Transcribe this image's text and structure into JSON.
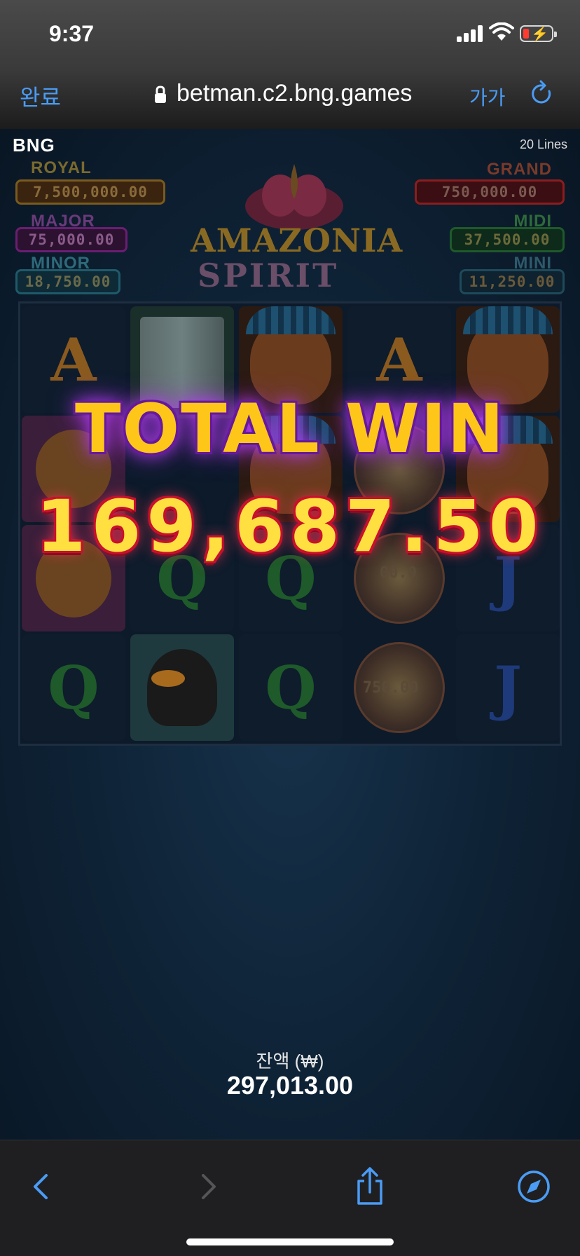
{
  "status_bar": {
    "time": "9:37"
  },
  "url_bar": {
    "done_label": "완료",
    "url": "betman.c2.bng.games",
    "text_size_label": "가가"
  },
  "game": {
    "provider_logo": "BNG",
    "lines_label": "20 Lines",
    "jackpots": {
      "royal": {
        "label": "ROYAL",
        "value": "7,500,000.00"
      },
      "major": {
        "label": "MAJOR",
        "value": "75,000.00"
      },
      "minor": {
        "label": "MINOR",
        "value": "18,750.00"
      },
      "grand": {
        "label": "GRAND",
        "value": "750,000.00"
      },
      "midi": {
        "label": "MIDI",
        "value": "37,500.00"
      },
      "mini": {
        "label": "MINI",
        "value": "11,250.00"
      }
    },
    "title_line1": "AMAZONIA",
    "title_line2": "SPIRIT",
    "reels": {
      "col1": [
        "A",
        "monkey",
        "monkey",
        "Q"
      ],
      "col2": [
        "waterfall",
        "Q",
        "toucan"
      ],
      "col3": [
        "chief",
        "chief",
        "Q",
        "Q"
      ],
      "col4": [
        "A",
        "butterfly",
        "butterfly",
        "butterfly"
      ],
      "col5": [
        "chief",
        "chief",
        "J",
        "J"
      ],
      "cell_values": {
        "c4r3": "00.0",
        "c4r4": "750.00"
      }
    },
    "total_win_label": "TOTAL WIN",
    "win_amount": "169,687.50",
    "balance_label": "잔액 (₩)",
    "balance_value": "297,013.00"
  },
  "toolbar": {
    "icons": [
      "back-icon",
      "forward-icon",
      "share-icon",
      "compass-icon"
    ]
  },
  "colors": {
    "safari_blue": "#4a9cf5",
    "win_gold": "#ffc61a",
    "win_purple": "#6a1aa0",
    "win_red": "#c8102e"
  }
}
